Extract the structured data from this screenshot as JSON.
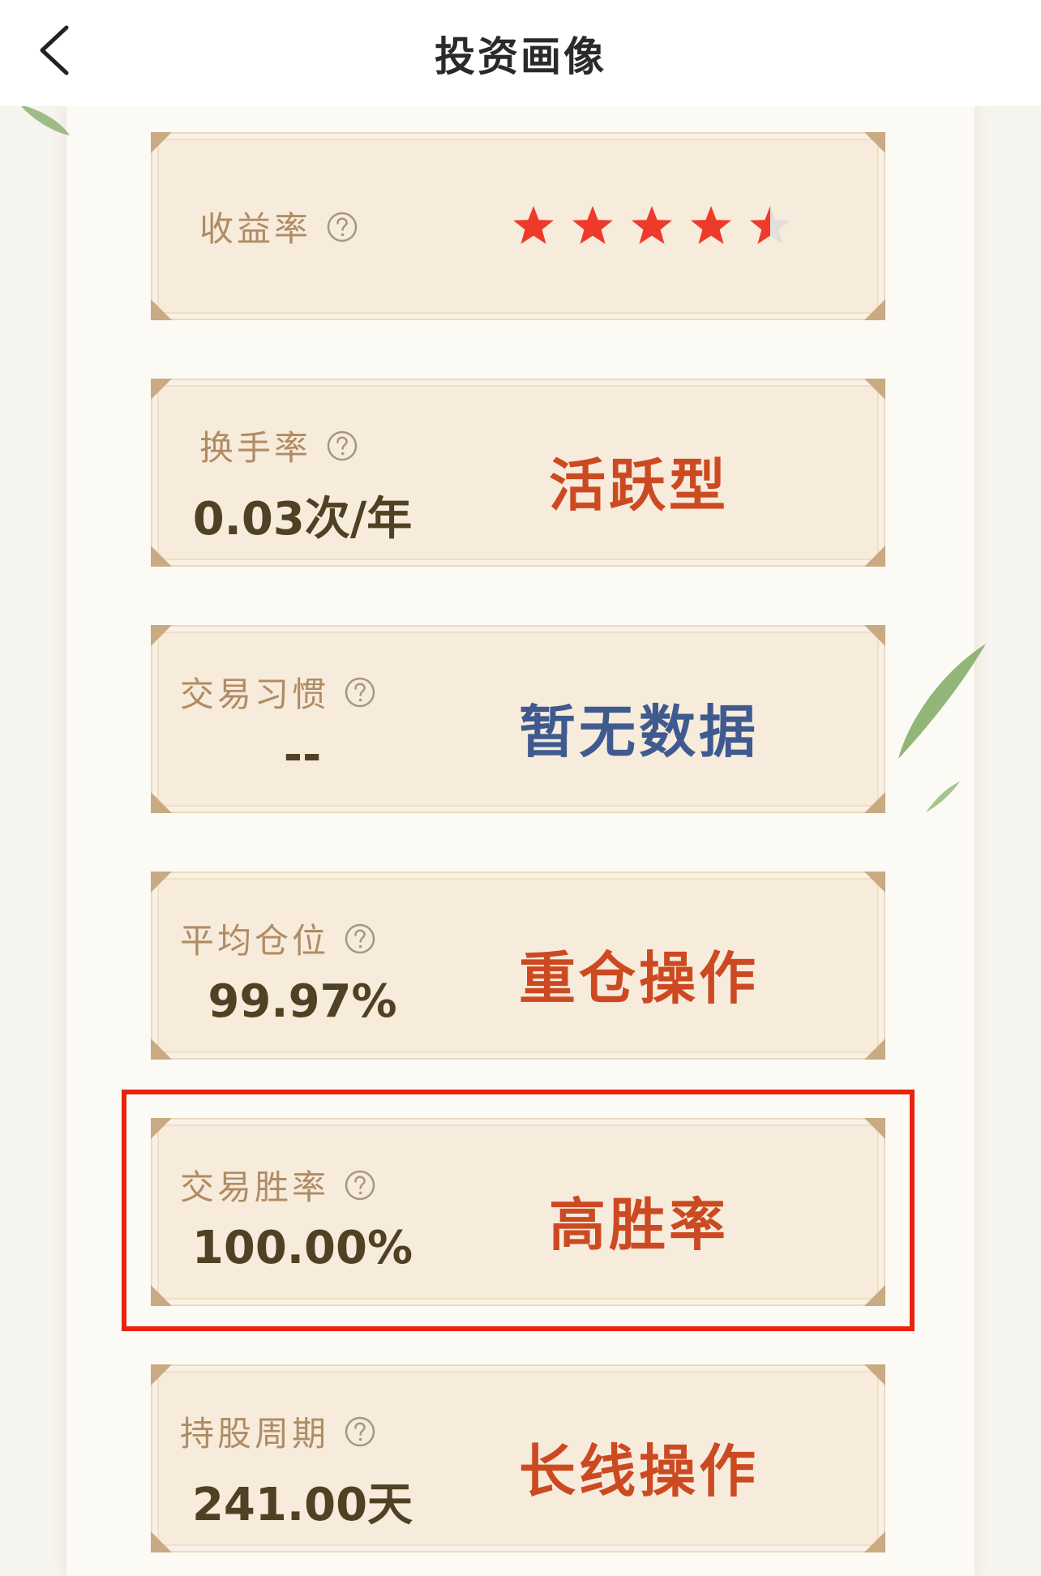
{
  "header": {
    "title": "投资画像"
  },
  "cards": [
    {
      "label": "收益率",
      "rating": 4.5
    },
    {
      "label": "换手率",
      "value": "0.03次/年",
      "tag": "活跃型"
    },
    {
      "label": "交易习惯",
      "value": "--",
      "tag": "暂无数据"
    },
    {
      "label": "平均仓位",
      "value": "99.97%",
      "tag": "重仓操作"
    },
    {
      "label": "交易胜率",
      "value": "100.00%",
      "tag": "高胜率"
    },
    {
      "label": "持股周期",
      "value": "241.00天",
      "tag": "长线操作"
    }
  ],
  "colors": {
    "tag_red": "#cc4a22",
    "tag_blue": "#3f5a8e",
    "star_red": "#ee3a2a",
    "highlight_border": "#e8230f",
    "label": "#b08c63",
    "value": "#4f4124"
  },
  "icons": {
    "back": "chevron-left-icon",
    "help": "question-circle-icon",
    "rating": "star-icon"
  }
}
